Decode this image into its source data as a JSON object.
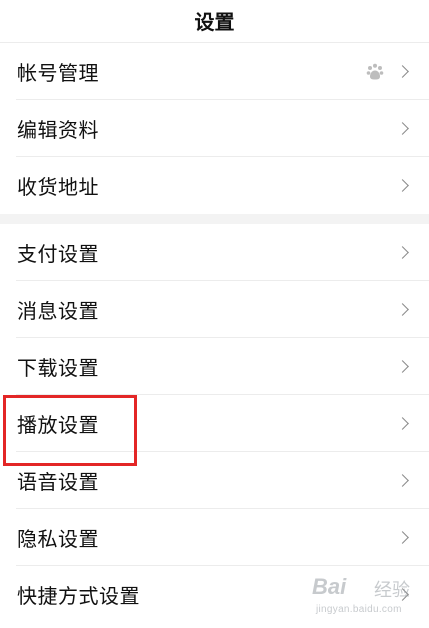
{
  "header": {
    "title": "设置"
  },
  "groups": [
    {
      "items": [
        {
          "label": "帐号管理",
          "icon": "baidu-paw-icon"
        },
        {
          "label": "编辑资料"
        },
        {
          "label": "收货地址"
        }
      ]
    },
    {
      "items": [
        {
          "label": "支付设置"
        },
        {
          "label": "消息设置"
        },
        {
          "label": "下载设置"
        },
        {
          "label": "播放设置",
          "highlighted": true
        },
        {
          "label": "语音设置"
        },
        {
          "label": "隐私设置"
        },
        {
          "label": "快捷方式设置"
        }
      ]
    }
  ],
  "watermark": {
    "brand": "Bai",
    "brand_suffix": "经验",
    "url": "jingyan.baidu.com"
  },
  "colors": {
    "highlight": "#e32626",
    "divider": "#ececec",
    "chevron": "#8a8a8a"
  }
}
